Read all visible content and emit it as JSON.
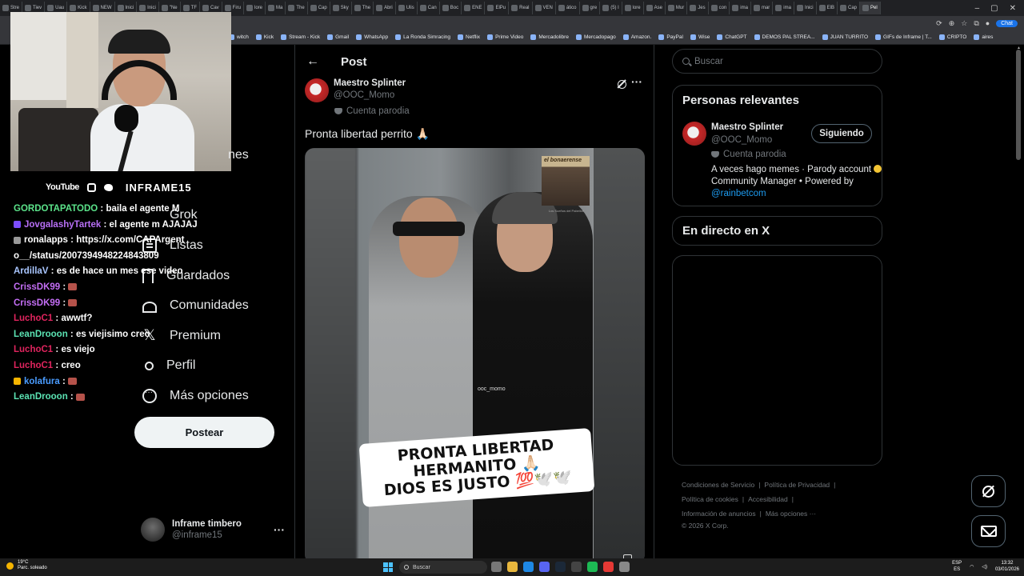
{
  "browser": {
    "tabs": [
      "Stre",
      "Tiev",
      "Uau",
      "Kick",
      "NEW",
      "Inici",
      "Inici",
      "\"Ne",
      "TF",
      "Cav",
      "Firu",
      "lore",
      "Ma",
      "The",
      "Cap",
      "Sky",
      "The",
      "Abri",
      "Ulis",
      "Can",
      "Boc",
      "ENE",
      "ElPu",
      "Real",
      "VEN",
      "ático",
      "gre",
      "(5) l",
      "lore",
      "Ase",
      "Mur",
      "Jes",
      "con",
      "ima",
      "mar",
      "ima",
      "Inici",
      "ElB",
      "Cap",
      "Pel"
    ],
    "chat_label": "Chat",
    "bookmarks": [
      "witch",
      "Kick",
      "Stream - Kick",
      "Gmail",
      "WhatsApp",
      "La Ronda Simracing",
      "Netflix",
      "Prime Video",
      "Mercadolibre",
      "Mercadopago",
      "Amazon.",
      "PayPal",
      "Wise",
      "ChatGPT",
      "DEMOS PAL STREA...",
      "JUAN TURRITO",
      "GIFs de Inframe | T...",
      "CRIPTO",
      "aires"
    ]
  },
  "stream": {
    "social": {
      "youtube": "YouTube",
      "channel": "INFRAME15"
    },
    "chat": [
      {
        "user": "GORDOTAPATODO",
        "color": "#5be38a",
        "text": "baila el agente M",
        "badge": ""
      },
      {
        "user": "JovgalashyTartek",
        "color": "#b76ff5",
        "text": "el agente m AJAJAJ",
        "badge": "#7c4dff"
      },
      {
        "user": "ronalapps",
        "color": "#ffffff",
        "text": "https://x.com/CAPArgento__/status/2007394948224843809",
        "badge": "#999999"
      },
      {
        "user": "ArdillaV",
        "color": "#a9c6ff",
        "text": "es de hace un mes ese video",
        "badge": ""
      },
      {
        "user": "CrissDK99",
        "color": "#c46ef5",
        "text": "",
        "badge": "",
        "emote": true
      },
      {
        "user": "CrissDK99",
        "color": "#c46ef5",
        "text": "",
        "badge": "",
        "emote": true
      },
      {
        "user": "LuchoC1",
        "color": "#e0245e",
        "text": "awwtf?",
        "badge": ""
      },
      {
        "user": "LeanDrooon",
        "color": "#5be3b3",
        "text": "es viejisimo creo",
        "badge": ""
      },
      {
        "user": "LuchoC1",
        "color": "#e0245e",
        "text": "es viejo",
        "badge": ""
      },
      {
        "user": "LuchoC1",
        "color": "#e0245e",
        "text": "creo",
        "badge": ""
      },
      {
        "user": "kolafura",
        "color": "#4a9cff",
        "text": "",
        "badge": "#f5b400",
        "emote": true
      },
      {
        "user": "LeanDrooon",
        "color": "#5be3b3",
        "text": "",
        "badge": "",
        "emote": true
      }
    ]
  },
  "nav": {
    "cut_text": "nes",
    "items": [
      "Grok",
      "Listas",
      "Guardados",
      "Comunidades",
      "Premium",
      "Perfil",
      "Más opciones"
    ],
    "post_button": "Postear",
    "account": {
      "name": "Inframe timbero",
      "handle": "@inframe15",
      "more": "···"
    }
  },
  "post": {
    "header_title": "Post",
    "back": "←",
    "author_name": "Maestro Splinter",
    "author_handle": "@OOC_Momo",
    "parody_label": "Cuenta parodia",
    "more": "···",
    "text": "Pronta libertad perrito 🙏🏻",
    "media": {
      "caption_line1": "PRONTA LIBERTAD HERMANITO 🙏🏻",
      "caption_line2": "DIOS ES JUSTO 💯🕊️🕊️",
      "watermark": "ooc_momo",
      "thumb_title": "el bonaerense",
      "thumb_sub": "Los Sueños del Pabellón"
    }
  },
  "sidebar": {
    "search_placeholder": "Buscar",
    "relevant_title": "Personas relevantes",
    "relevant": {
      "name": "Maestro Splinter",
      "handle": "@OOC_Momo",
      "parody": "Cuenta parodia",
      "bio_pre": "A veces hago memes · Parody account ",
      "bio_mid": " Community Manager • Powered by ",
      "bio_link": "@rainbetcom",
      "follow": "Siguiendo"
    },
    "live_title": "En directo en X",
    "footer": [
      "Condiciones de Servicio",
      "Política de Privacidad",
      "Política de cookies",
      "Accesibilidad",
      "Información de anuncios",
      "Más opciones ···",
      "© 2026 X Corp."
    ]
  },
  "taskbar": {
    "weather_temp": "19°C",
    "weather_desc": "Parc. soleado",
    "search": "Buscar",
    "lang1": "ESP",
    "lang2": "ES",
    "time": "13:32",
    "date": "03/01/2026"
  }
}
